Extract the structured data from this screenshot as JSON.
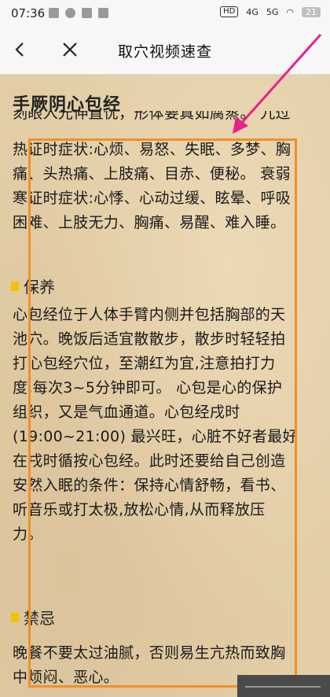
{
  "status": {
    "time": "07:36",
    "hd_badge": "HD",
    "net1": "4G",
    "net2": "5G",
    "battery": "21"
  },
  "nav": {
    "title": "取穴视频速查"
  },
  "article": {
    "heading": "手厥阴心包经",
    "partial_top": "刻眼入光伸直忧，形体要真如腐蒸。 九过",
    "lines1": [
      "热证时症状:心烦、易怒、失眠、多梦、胸",
      "痛、头热痛、上肢痛、目赤、便秘。 衰弱",
      "寒证时症状:心悸、心动过缓、眩晕、呼吸",
      "困难、上肢无力、胸痛、易醒、难入睡。"
    ],
    "section1_title": "保养",
    "lines2": [
      "心包经位于人体手臂内侧并包括胸部的天",
      "池穴。晚饭后适宜散散步，散步时轻轻拍",
      "打心包经穴位，至潮红为宜,注意拍打力",
      "度,每次3~5分钟即可。 心包是心的保护",
      "组织，又是气血通道。心包经戌时",
      "(19:00~21:00) 最兴旺，心脏不好者最好",
      "在戌时循按心包经。此时还要给自己创造",
      "安然入眠的条件：保持心情舒畅，看书、",
      "听音乐或打太极,放松心情,从而释放压",
      "力。"
    ],
    "section2_title": "禁忌",
    "lines3": [
      "晚餐不要太过油腻，否则易生亢热而致胸",
      "中烦闷、恶心。"
    ]
  },
  "colors": {
    "highlight_box": "#f0902a",
    "arrow": "#e8228a",
    "section_marker": "#f2c200"
  }
}
